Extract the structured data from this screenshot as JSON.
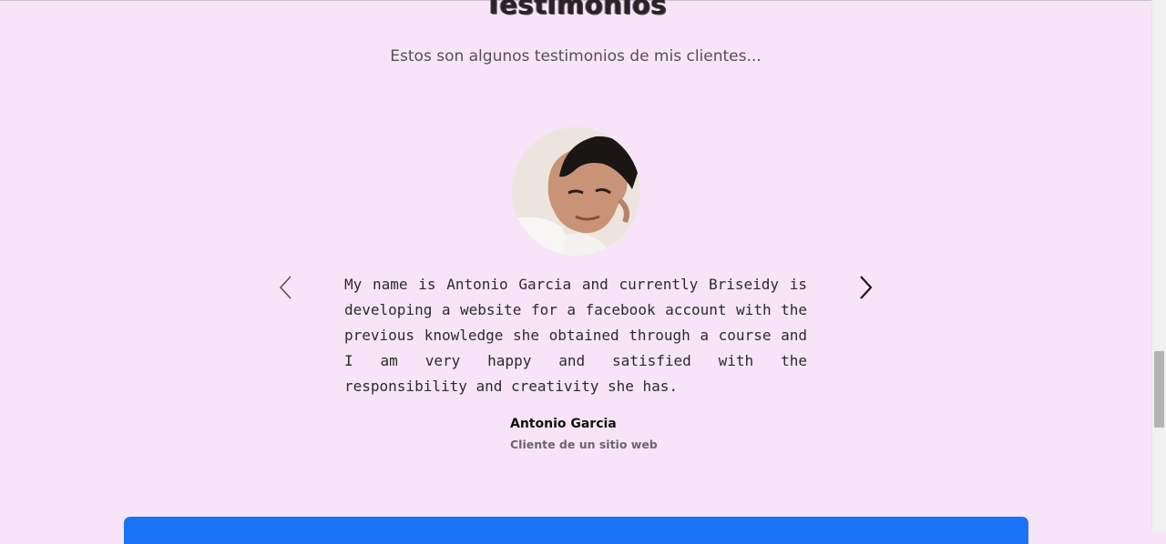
{
  "section": {
    "title": "Testimonios",
    "subtitle": "Estos son algunos testimonios de mis clientes..."
  },
  "testimonial": {
    "quote": "My name is Antonio Garcia and currently Briseidy is developing a website for a facebook account with the previous knowledge she obtained through a course and I am very happy and satisfied with the responsibility and creativity she has.",
    "author_name": "Antonio Garcia",
    "author_role": "Cliente de un sitio web"
  },
  "carousel": {
    "prev_icon": "chevron-left-icon",
    "next_icon": "chevron-right-icon"
  },
  "colors": {
    "background": "#f7e4f8",
    "accent_bar": "#1a73f5"
  }
}
